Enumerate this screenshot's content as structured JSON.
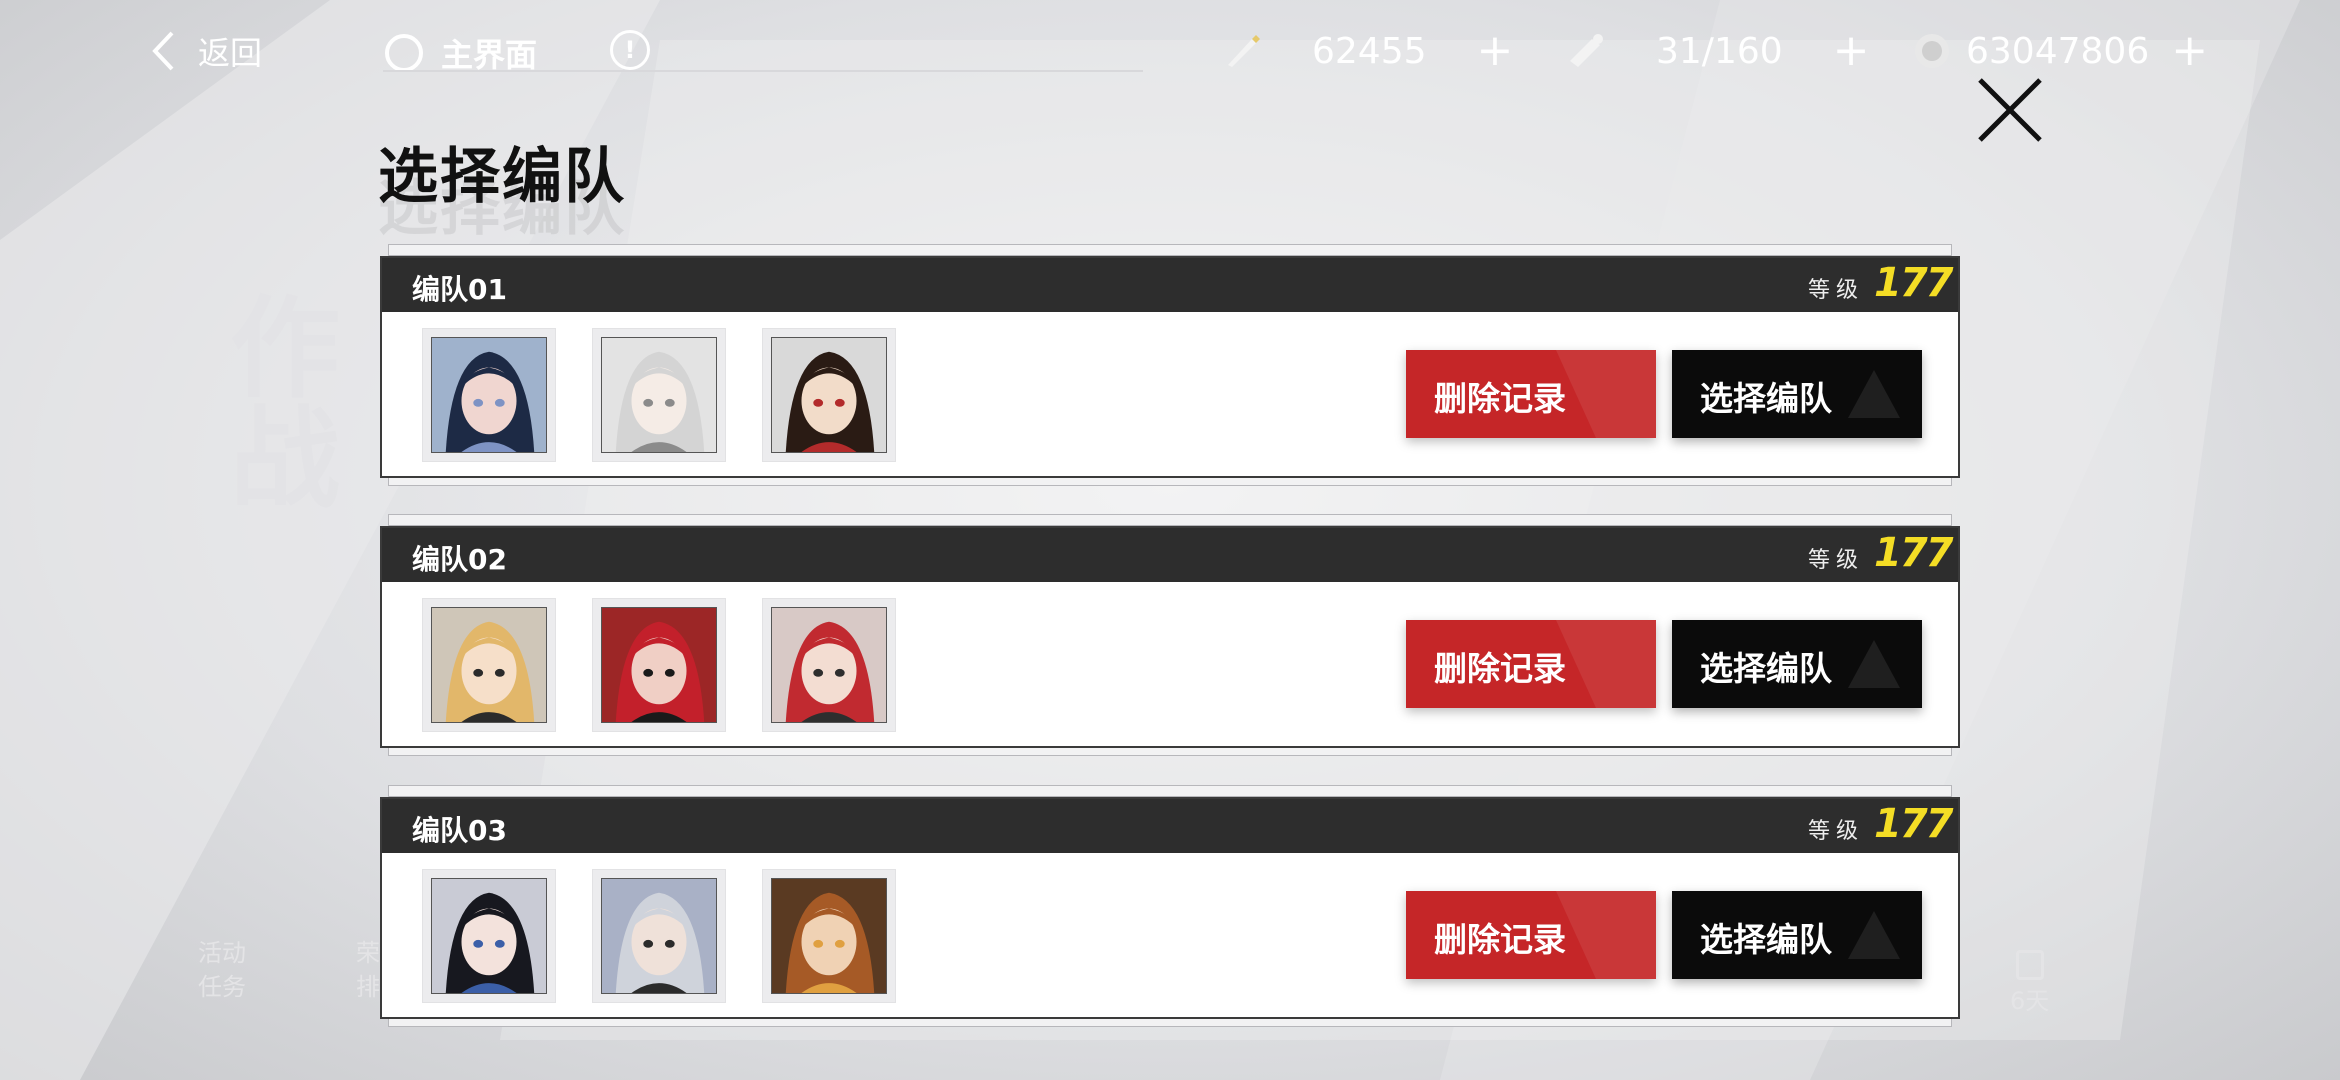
{
  "background": {
    "left_tag_line1": "活动",
    "left_tag_line2": "任务",
    "left_tag2_line1": "荣誉",
    "left_tag2_line2": "排行",
    "right_tag": "6天",
    "ghost_text": "作战"
  },
  "topbar": {
    "back_label": "返回",
    "home_label": "主界面",
    "info_symbol": "!",
    "resources": [
      {
        "icon": "pen-icon",
        "value": "62455"
      },
      {
        "icon": "stamina-icon",
        "value": "31/160"
      },
      {
        "icon": "coin-icon",
        "value": "63047806"
      }
    ],
    "plus_symbol": "+"
  },
  "title": "选择编队",
  "teams": [
    {
      "name": "编队01",
      "level_label": "等级",
      "level": "177",
      "delete_label": "删除记录",
      "select_label": "选择编队",
      "portraits": [
        {
          "icon": "character-portrait-blue-hair",
          "bg": "#9fb2cc",
          "hair": "#1d2a45",
          "skin": "#f0d6d0",
          "accent": "#7e93c4"
        },
        {
          "icon": "character-portrait-white-hair",
          "bg": "#e3e3e3",
          "hair": "#d4d4d4",
          "skin": "#f5ece6",
          "accent": "#8b8b8b"
        },
        {
          "icon": "character-portrait-dark-hair",
          "bg": "#d9d9d9",
          "hair": "#2a1b14",
          "skin": "#f2dcc9",
          "accent": "#b32b2b"
        }
      ]
    },
    {
      "name": "编队02",
      "level_label": "等级",
      "level": "177",
      "delete_label": "删除记录",
      "select_label": "选择编队",
      "portraits": [
        {
          "icon": "character-portrait-blonde-hair",
          "bg": "#cfc6b8",
          "hair": "#e2b76a",
          "skin": "#f6dfc9",
          "accent": "#2b2b2b"
        },
        {
          "icon": "character-portrait-red-hair",
          "bg": "#9c2626",
          "hair": "#c3202b",
          "skin": "#f0cfc5",
          "accent": "#1a1a1a"
        },
        {
          "icon": "character-portrait-red-hair-profile",
          "bg": "#d8c9c6",
          "hair": "#c12a30",
          "skin": "#f3ddd2",
          "accent": "#2e2e2e"
        }
      ]
    },
    {
      "name": "编队03",
      "level_label": "等级",
      "level": "177",
      "delete_label": "删除记录",
      "select_label": "选择编队",
      "portraits": [
        {
          "icon": "character-portrait-black-hair",
          "bg": "#c9cbd5",
          "hair": "#17181f",
          "skin": "#f3e2dc",
          "accent": "#3b5fa8"
        },
        {
          "icon": "character-portrait-silver-hair",
          "bg": "#a9b1c6",
          "hair": "#cfd3db",
          "skin": "#efe1d9",
          "accent": "#2b2b2b"
        },
        {
          "icon": "character-portrait-brown-hair",
          "bg": "#5a3a22",
          "hair": "#a65a26",
          "skin": "#f0d2b4",
          "accent": "#e0a040"
        }
      ]
    }
  ],
  "colors": {
    "delete": "#c52628",
    "select": "#0b0b0b",
    "level": "#f4dd25",
    "header": "#2d2d2d"
  }
}
